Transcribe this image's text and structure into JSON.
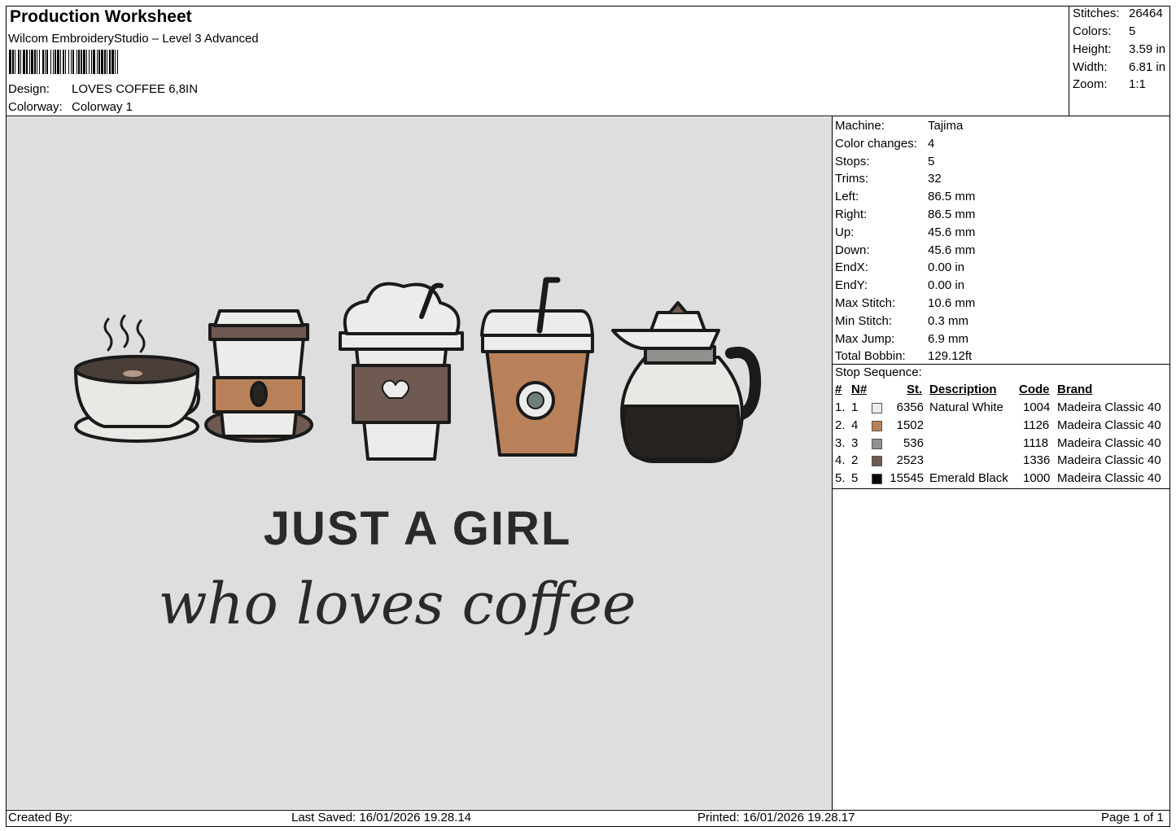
{
  "header": {
    "title": "Production Worksheet",
    "software": "Wilcom EmbroideryStudio – Level 3 Advanced",
    "design_label": "Design:",
    "design_value": "LOVES COFFEE 6,8IN",
    "colorway_label": "Colorway:",
    "colorway_value": "Colorway 1"
  },
  "summary": {
    "stitches_label": "Stitches:",
    "stitches": "26464",
    "colors_label": "Colors:",
    "colors": "5",
    "height_label": "Height:",
    "height": "3.59 in",
    "width_label": "Width:",
    "width": "6.81 in",
    "zoom_label": "Zoom:",
    "zoom": "1:1"
  },
  "machine_info": [
    {
      "label": "Machine:",
      "value": "Tajima"
    },
    {
      "label": "Color changes:",
      "value": "4"
    },
    {
      "label": "Stops:",
      "value": "5"
    },
    {
      "label": "Trims:",
      "value": "32"
    },
    {
      "label": "Left:",
      "value": "86.5 mm"
    },
    {
      "label": "Right:",
      "value": "86.5 mm"
    },
    {
      "label": "Up:",
      "value": "45.6 mm"
    },
    {
      "label": "Down:",
      "value": "45.6 mm"
    },
    {
      "label": "EndX:",
      "value": "0.00 in"
    },
    {
      "label": "EndY:",
      "value": "0.00 in"
    },
    {
      "label": "Max Stitch:",
      "value": "10.6 mm"
    },
    {
      "label": "Min Stitch:",
      "value": "0.3 mm"
    },
    {
      "label": "Max Jump:",
      "value": "6.9 mm"
    },
    {
      "label": "Total Bobbin:",
      "value": "129.12ft"
    }
  ],
  "stop_sequence": {
    "title": "Stop Sequence:",
    "headers": {
      "num": "#",
      "n": "N#",
      "st": "St.",
      "description": "Description",
      "code": "Code",
      "brand": "Brand"
    },
    "rows": [
      {
        "num": "1.",
        "n": "1",
        "color": "#ececea",
        "st": "6356",
        "description": "Natural White",
        "code": "1004",
        "brand": "Madeira Classic 40"
      },
      {
        "num": "2.",
        "n": "4",
        "color": "#b98159",
        "st": "1502",
        "description": "",
        "code": "1126",
        "brand": "Madeira Classic 40"
      },
      {
        "num": "3.",
        "n": "3",
        "color": "#8e918c",
        "st": "536",
        "description": "",
        "code": "1118",
        "brand": "Madeira Classic 40"
      },
      {
        "num": "4.",
        "n": "2",
        "color": "#6e5a50",
        "st": "2523",
        "description": "",
        "code": "1336",
        "brand": "Madeira Classic 40"
      },
      {
        "num": "5.",
        "n": "5",
        "color": "#0a0a0a",
        "st": "15545",
        "description": "Emerald Black",
        "code": "1000",
        "brand": "Madeira Classic 40"
      }
    ]
  },
  "design_text": {
    "line1": "JUST A GIRL",
    "line2": "who loves coffee"
  },
  "footer": {
    "created_by": "Created By:",
    "last_saved": "Last Saved: 16/01/2026 19.28.14",
    "printed": "Printed: 16/01/2026 19.28.17",
    "page": "Page 1 of 1"
  }
}
